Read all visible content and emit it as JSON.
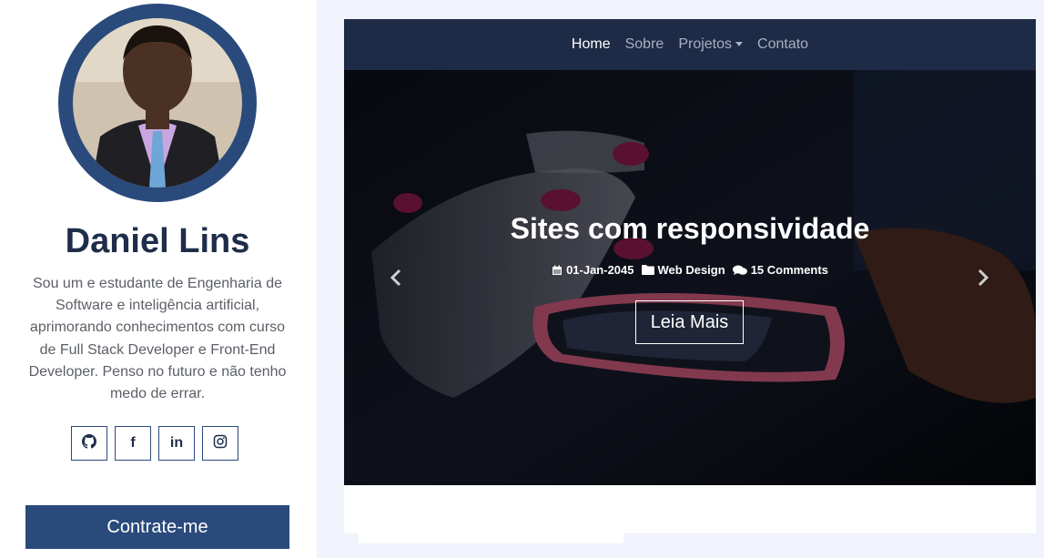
{
  "profile": {
    "name": "Daniel Lins",
    "bio": "Sou um e estudante de Engenharia de Software e inteligência artificial, aprimorando conhecimentos com curso de Full Stack Developer e Front-End Developer. Penso no futuro e não tenho medo de errar.",
    "socials": [
      {
        "icon": "github-icon"
      },
      {
        "icon": "facebook-icon",
        "glyph": "f"
      },
      {
        "icon": "linkedin-icon",
        "glyph": "in"
      },
      {
        "icon": "instagram-icon"
      }
    ],
    "hire_label": "Contrate-me"
  },
  "nav": {
    "items": [
      {
        "label": "Home",
        "active": true
      },
      {
        "label": "Sobre"
      },
      {
        "label": "Projetos",
        "dropdown": true
      },
      {
        "label": "Contato"
      }
    ]
  },
  "hero": {
    "title": "Sites com responsividade",
    "date": "01-Jan-2045",
    "category": "Web Design",
    "comments": "15 Comments",
    "button_label": "Leia Mais"
  },
  "colors": {
    "accent": "#2a4a7c",
    "navbar": "#1d2b47",
    "page_bg": "#f0f3fb",
    "name_text": "#1f2d4a"
  }
}
